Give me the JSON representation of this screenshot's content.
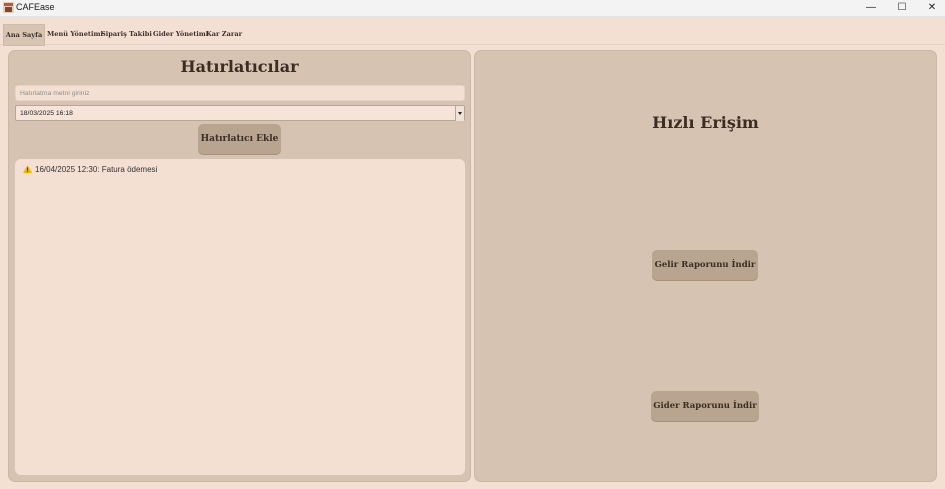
{
  "window": {
    "title": "CAFEase",
    "minimize_glyph": "—",
    "maximize_glyph": "☐",
    "close_glyph": "✕"
  },
  "tabs": [
    {
      "label": "Ana Sayfa",
      "active": true
    },
    {
      "label": "Menü Yönetimi",
      "active": false
    },
    {
      "label": "Sipariş Takibi",
      "active": false
    },
    {
      "label": "Gider Yönetimi",
      "active": false
    },
    {
      "label": "Kar Zarar",
      "active": false
    }
  ],
  "reminders": {
    "title": "Hatırlatıcılar",
    "text_placeholder": "Hatırlatma metni giriniz",
    "datetime_value": "18/03/2025 16:18",
    "add_button": "Hatırlatıcı Ekle",
    "items": [
      {
        "icon": "warning-icon",
        "text": "16/04/2025 12:30: Fatura ödemesi"
      }
    ]
  },
  "quick_access": {
    "title": "Hızlı Erişim",
    "income_report_button": "Gelir Raporunu İndir",
    "expense_report_button": "Gider Raporunu İndir"
  },
  "colors": {
    "background": "#f3e0d3",
    "panel": "#d6c3b2",
    "button": "#b9a48f",
    "text_dark": "#3a2e24"
  }
}
